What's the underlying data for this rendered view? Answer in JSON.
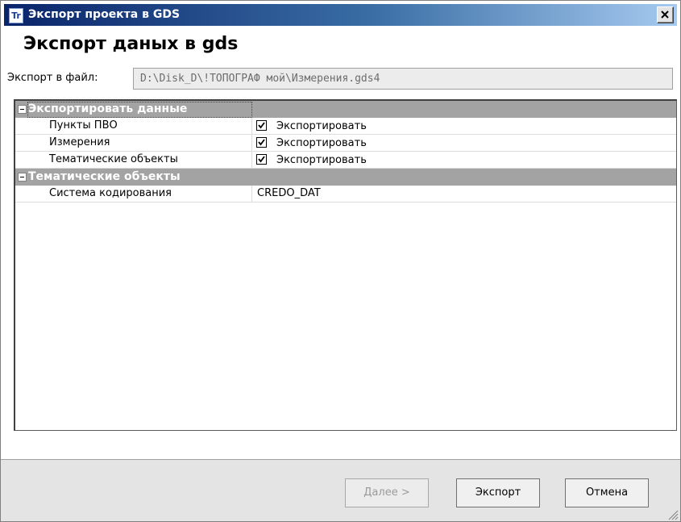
{
  "window": {
    "title": "Экспорт проекта в GDS",
    "icon_text": "Tr",
    "close_glyph": "✕"
  },
  "header": {
    "heading": "Экспорт даных в gds"
  },
  "file": {
    "label": "Экспорт в файл:",
    "path": "D:\\Disk_D\\!ТОПОГРАФ мой\\Измерения.gds4"
  },
  "grid": {
    "category1": {
      "label": "Экспортировать данные",
      "rows": [
        {
          "name": "Пункты ПВО",
          "checked": true,
          "value": "Экспортировать"
        },
        {
          "name": "Измерения",
          "checked": true,
          "value": "Экспортировать"
        },
        {
          "name": "Тематические объекты",
          "checked": true,
          "value": "Экспортировать"
        }
      ]
    },
    "category2": {
      "label": "Тематические объекты",
      "rows": [
        {
          "name": "Система кодирования",
          "value": "CREDO_DAT"
        }
      ]
    }
  },
  "buttons": {
    "next_accel": "Д",
    "next_rest": "алее >",
    "export": "Экспорт",
    "cancel": "Отмена"
  },
  "colors": {
    "title_gradient_start": "#0a246a",
    "category_bg": "#a3a3a3",
    "footer_bg": "#e4e4e4"
  }
}
